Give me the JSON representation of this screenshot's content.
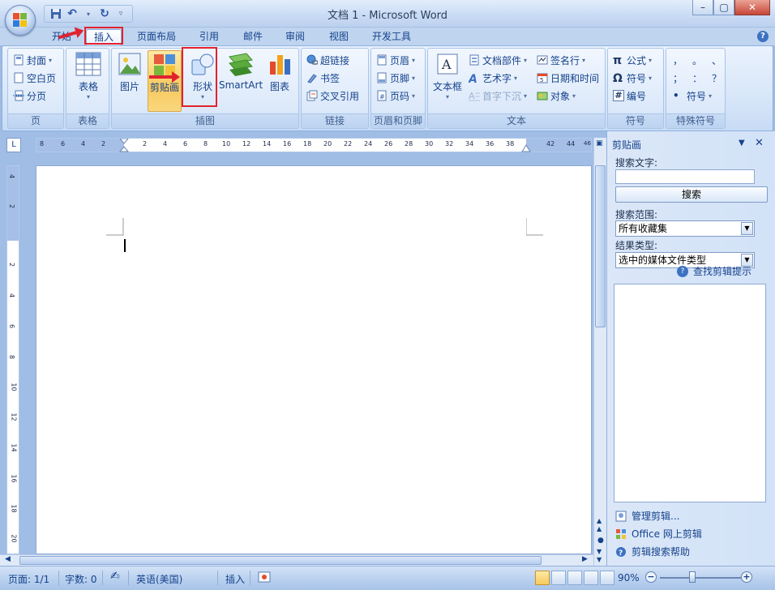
{
  "title_bar": {
    "title": "文档 1 - Microsoft Word",
    "quick_access": [
      "save-icon",
      "undo-icon",
      "redo-icon",
      "customize-qat-icon"
    ],
    "window_controls": [
      "minimize",
      "maximize",
      "close"
    ]
  },
  "tabs": [
    {
      "label": "开始",
      "active": false
    },
    {
      "label": "插入",
      "active": true
    },
    {
      "label": "页面布局",
      "active": false
    },
    {
      "label": "引用",
      "active": false
    },
    {
      "label": "邮件",
      "active": false
    },
    {
      "label": "审阅",
      "active": false
    },
    {
      "label": "视图",
      "active": false
    },
    {
      "label": "开发工具",
      "active": false
    }
  ],
  "ribbon": {
    "pages": {
      "label": "页",
      "items": [
        "封面",
        "空白页",
        "分页"
      ]
    },
    "tables": {
      "label": "表格",
      "button": "表格"
    },
    "illustrations": {
      "label": "插图",
      "buttons": [
        "图片",
        "剪贴画",
        "形状",
        "SmartArt",
        "图表"
      ]
    },
    "links": {
      "label": "链接",
      "items": [
        "超链接",
        "书签",
        "交叉引用"
      ]
    },
    "header_footer": {
      "label": "页眉和页脚",
      "items": [
        "页眉",
        "页脚",
        "页码"
      ]
    },
    "text": {
      "label": "文本",
      "button": "文本框",
      "items": [
        "文档部件",
        "艺术字",
        "首字下沉",
        "签名行",
        "日期和时间",
        "对象"
      ]
    },
    "symbols": {
      "label": "符号",
      "items": [
        "公式",
        "符号",
        "编号"
      ],
      "icons": [
        "π",
        "Ω",
        "#"
      ]
    },
    "special_symbols": {
      "label": "特殊符号",
      "chars": [
        "，",
        "。",
        "、",
        "；",
        "：",
        "？"
      ],
      "item": "符号"
    }
  },
  "ruler": {
    "h_numbers": [
      "8",
      "6",
      "4",
      "2",
      "2",
      "4",
      "6",
      "8",
      "10",
      "12",
      "14",
      "16",
      "18",
      "20",
      "22",
      "24",
      "26",
      "28",
      "30",
      "32",
      "34",
      "36",
      "38",
      "42",
      "44",
      "46"
    ],
    "v_numbers": [
      "4",
      "2",
      "2",
      "4",
      "6",
      "8",
      "10",
      "12",
      "14",
      "16",
      "18",
      "20"
    ]
  },
  "clipart_pane": {
    "title": "剪贴画",
    "search_label": "搜索文字:",
    "search_value": "",
    "search_button": "搜索",
    "scope_label": "搜索范围:",
    "scope_value": "所有收藏集",
    "type_label": "结果类型:",
    "type_value": "选中的媒体文件类型",
    "tips_link": "查找剪辑提示",
    "bottom_links": [
      "管理剪辑...",
      "Office 网上剪辑",
      "剪辑搜索帮助"
    ]
  },
  "status_bar": {
    "page": "页面: 1/1",
    "words": "字数: 0",
    "language": "英语(美国)",
    "mode": "插入",
    "zoom": "90%"
  }
}
